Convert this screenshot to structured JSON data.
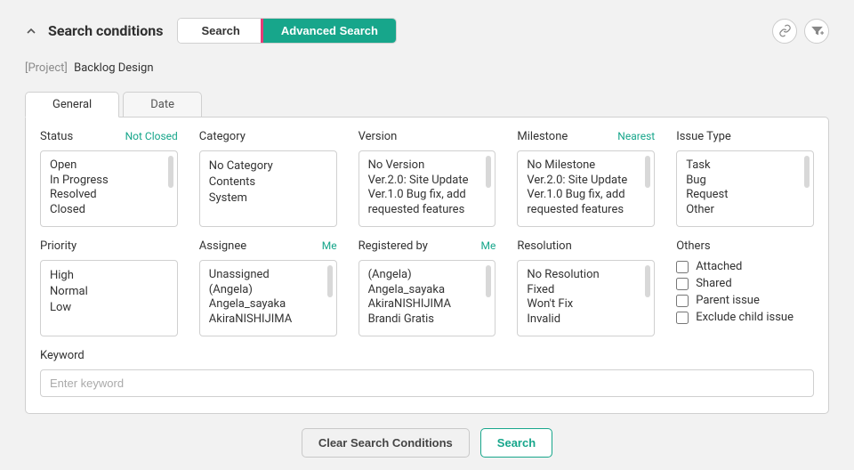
{
  "header": {
    "title": "Search conditions",
    "search_label": "Search",
    "advanced_label": "Advanced Search"
  },
  "project": {
    "prefix": "[Project]",
    "name": "Backlog Design"
  },
  "tabs": {
    "general": "General",
    "date": "Date"
  },
  "fields": {
    "status": {
      "label": "Status",
      "link": "Not Closed",
      "items": [
        "Open",
        "In Progress",
        "Resolved",
        "Closed"
      ]
    },
    "category": {
      "label": "Category",
      "items": [
        "No Category",
        "Contents",
        "System"
      ]
    },
    "version": {
      "label": "Version",
      "items": [
        "No Version",
        "Ver.2.0: Site Update",
        "Ver.1.0 Bug fix, add requested features"
      ]
    },
    "milestone": {
      "label": "Milestone",
      "link": "Nearest",
      "items": [
        "No Milestone",
        "Ver.2.0: Site Update",
        "Ver.1.0 Bug fix, add requested features"
      ]
    },
    "issuetype": {
      "label": "Issue Type",
      "items": [
        "Task",
        "Bug",
        "Request",
        "Other"
      ]
    },
    "priority": {
      "label": "Priority",
      "items": [
        "High",
        "Normal",
        "Low"
      ]
    },
    "assignee": {
      "label": "Assignee",
      "link": "Me",
      "items": [
        "Unassigned",
        "(Angela)",
        "Angela_sayaka",
        "AkiraNISHIJIMA"
      ]
    },
    "registeredby": {
      "label": "Registered by",
      "link": "Me",
      "items": [
        "(Angela)",
        "Angela_sayaka",
        "AkiraNISHIJIMA",
        "Brandi Gratis"
      ]
    },
    "resolution": {
      "label": "Resolution",
      "items": [
        "No Resolution",
        "Fixed",
        "Won't Fix",
        "Invalid"
      ]
    },
    "others": {
      "label": "Others",
      "items": [
        "Attached",
        "Shared",
        "Parent issue",
        "Exclude child issue"
      ]
    }
  },
  "keyword": {
    "label": "Keyword",
    "placeholder": "Enter keyword"
  },
  "footer": {
    "clear": "Clear Search Conditions",
    "search": "Search"
  }
}
